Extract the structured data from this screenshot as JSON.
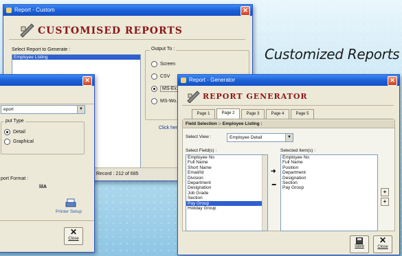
{
  "caption": "Customized Reports",
  "win_custom": {
    "title": "Report - Custom",
    "header": "CUSTOMISED REPORTS",
    "select_label": "Select Report to Generate :",
    "selected_report": "Employee Listing",
    "output_label": "Output To :",
    "outputs": [
      {
        "label": "Screen",
        "checked": false
      },
      {
        "label": "CSV",
        "checked": false
      },
      {
        "label": "MS-Ex...",
        "checked": true
      },
      {
        "label": "MS-Wo...",
        "checked": false
      }
    ],
    "click_text": "Click here",
    "status": "Record : 212 of 685"
  },
  "win_left": {
    "title": "",
    "select_value": "eport",
    "output_type_label": "put Type",
    "types": [
      {
        "label": "Detail",
        "selected": true
      },
      {
        "label": "Graphical",
        "selected": false
      }
    ],
    "format_label": "port Format :",
    "format_value": "lilA",
    "printer_label": "Printer Setup",
    "close_label": "Close"
  },
  "win_gen": {
    "title": "Report - Generator",
    "header": "REPORT GENERATOR",
    "tabs": [
      "Page 1",
      "Page 2",
      "Page 3",
      "Page 4",
      "Page 5"
    ],
    "active_tab": 1,
    "section_title": "Field Selection :- Employee Listing :",
    "view_label": "Select View :",
    "view_value": "Employee Detail",
    "fields_label": "Select Field(s) :",
    "selected_label": "Selected Item(s) :",
    "fields": [
      "Employee No",
      "Full Name",
      "Short Name",
      "Email/Id",
      "Division",
      "Department",
      "Designation",
      "Job Grade",
      "Section",
      "Pay Group",
      "Holiday Group"
    ],
    "fields_highlight": 9,
    "selected_items": [
      "Employee No",
      "Full Name",
      "Position",
      "Department",
      "Designation",
      "Section",
      "Pay Group"
    ],
    "save_label": "Save",
    "close_label": "Close"
  }
}
